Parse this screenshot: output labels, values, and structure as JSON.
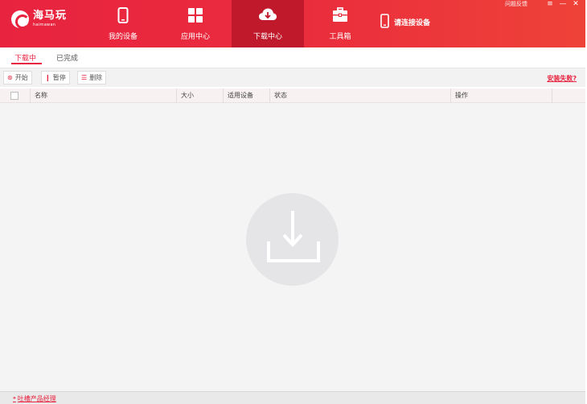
{
  "app": {
    "logo_title": "海马玩",
    "logo_subtitle": "haimawan"
  },
  "nav": {
    "tabs": [
      {
        "label": "我的设备",
        "icon": "phone-icon"
      },
      {
        "label": "应用中心",
        "icon": "grid-icon"
      },
      {
        "label": "下载中心",
        "icon": "cloud-download-icon",
        "active": true
      },
      {
        "label": "工具箱",
        "icon": "toolbox-icon"
      }
    ],
    "connect_label": "请连接设备"
  },
  "window": {
    "feedback_label": "问题反馈",
    "menu_symbol": "≡",
    "minimize_symbol": "—",
    "close_symbol": "✕"
  },
  "subtabs": [
    {
      "label": "下载中",
      "active": true
    },
    {
      "label": "已完成"
    }
  ],
  "toolbar": {
    "start_label": "开始",
    "start_icon": "⊛",
    "pause_label": "暂停",
    "pause_icon": "❙",
    "delete_label": "删除",
    "delete_icon": "☰",
    "install_fail_label": "安装失败?"
  },
  "table": {
    "columns": [
      "名称",
      "大小",
      "适用设备",
      "状态",
      "操作"
    ]
  },
  "empty_state": {
    "icon": "download-tray-icon"
  },
  "footer": {
    "feedback_link": "吐槽产品经理",
    "feedback_icon": "❝"
  },
  "colors": {
    "brand_red": "#e8233f",
    "active_tab": "#c0192c",
    "empty_bg": "#f4f4f4"
  }
}
